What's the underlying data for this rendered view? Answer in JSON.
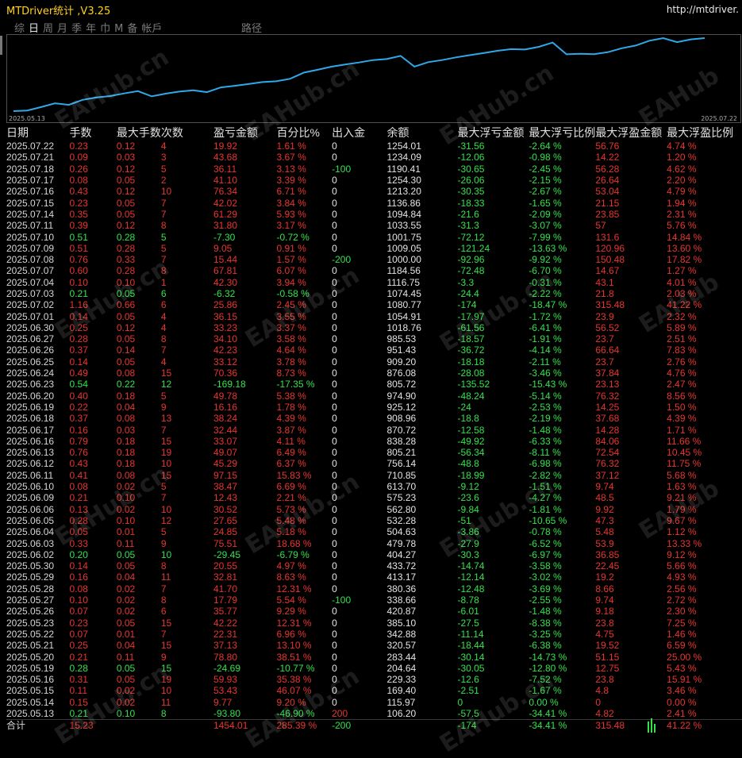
{
  "window": {
    "title": "MTDriver统计 ,V3.25",
    "url": "http://mtdriver."
  },
  "tabs": [
    "综",
    "日",
    "周",
    "月",
    "季",
    "年",
    "巾",
    "M",
    "备",
    "帐戶"
  ],
  "active_tab": 1,
  "path_label": "路径",
  "chart": {
    "x_start": "2025.05.13",
    "x_end": "2025.07.22",
    "line_color": "#2fa8e8",
    "series": [
      106.2,
      115.97,
      169.4,
      229.33,
      204.64,
      283.44,
      320.57,
      342.88,
      385.1,
      420.87,
      338.66,
      380.36,
      413.17,
      433.72,
      404.27,
      479.78,
      504.63,
      532.28,
      562.8,
      575.23,
      613.7,
      710.85,
      756.14,
      805.21,
      838.28,
      870.72,
      908.96,
      925.12,
      974.9,
      805.72,
      876.08,
      909.2,
      951.43,
      985.53,
      1018.76,
      1054.91,
      1080.77,
      1074.45,
      1116.75,
      1184.56,
      1000.0,
      1009.05,
      1001.75,
      1033.55,
      1094.84,
      1136.86,
      1213.2,
      1254.3,
      1190.41,
      1234.09,
      1254.01
    ]
  },
  "table": {
    "headers": [
      "日期",
      "手数",
      "最大手数",
      "次数",
      "盈亏金额",
      "百分比%",
      "出入金",
      "余额",
      "最大浮亏金额",
      "最大浮亏比例",
      "最大浮盈金额",
      "最大浮盈比例"
    ],
    "rows": [
      [
        "2025.07.22",
        "0.23",
        "0.12",
        "4",
        "19.92",
        "1.61 %",
        "0",
        "1254.01",
        "-31.56",
        "-2.64 %",
        "56.76",
        "4.74 %"
      ],
      [
        "2025.07.21",
        "0.09",
        "0.03",
        "3",
        "43.68",
        "3.67 %",
        "0",
        "1234.09",
        "-12.06",
        "-0.98 %",
        "14.22",
        "1.20 %"
      ],
      [
        "2025.07.18",
        "0.26",
        "0.12",
        "5",
        "36.11",
        "3.13 %",
        "-100",
        "1190.41",
        "-30.65",
        "-2.45 %",
        "56.28",
        "4.62 %"
      ],
      [
        "2025.07.17",
        "0.08",
        "0.05",
        "2",
        "41.10",
        "3.39 %",
        "0",
        "1254.30",
        "-26.06",
        "-2.15 %",
        "26.64",
        "2.20 %"
      ],
      [
        "2025.07.16",
        "0.43",
        "0.12",
        "10",
        "76.34",
        "6.71 %",
        "0",
        "1213.20",
        "-30.35",
        "-2.67 %",
        "53.04",
        "4.79 %"
      ],
      [
        "2025.07.15",
        "0.23",
        "0.05",
        "7",
        "42.02",
        "3.84 %",
        "0",
        "1136.86",
        "-18.33",
        "-1.65 %",
        "21.15",
        "1.94 %"
      ],
      [
        "2025.07.14",
        "0.35",
        "0.05",
        "7",
        "61.29",
        "5.93 %",
        "0",
        "1094.84",
        "-21.6",
        "-2.09 %",
        "23.85",
        "2.31 %"
      ],
      [
        "2025.07.11",
        "0.39",
        "0.12",
        "8",
        "31.80",
        "3.17 %",
        "0",
        "1033.55",
        "-31.3",
        "-3.07 %",
        "57",
        "5.76 %"
      ],
      [
        "2025.07.10",
        "0.51",
        "0.28",
        "5",
        "-7.30",
        "-0.72 %",
        "0",
        "1001.75",
        "-72.12",
        "-7.99 %",
        "131.6",
        "14.84 %"
      ],
      [
        "2025.07.09",
        "0.51",
        "0.28",
        "5",
        "9.05",
        "0.91 %",
        "0",
        "1009.05",
        "-121.24",
        "-13.63 %",
        "120.96",
        "13.60 %"
      ],
      [
        "2025.07.08",
        "0.76",
        "0.33",
        "7",
        "15.44",
        "1.57 %",
        "-200",
        "1000.00",
        "-92.96",
        "-9.92 %",
        "150.48",
        "17.82 %"
      ],
      [
        "2025.07.07",
        "0.60",
        "0.28",
        "8",
        "67.81",
        "6.07 %",
        "0",
        "1184.56",
        "-72.48",
        "-6.70 %",
        "14.67",
        "1.27 %"
      ],
      [
        "2025.07.04",
        "0.10",
        "0.10",
        "1",
        "42.30",
        "3.94 %",
        "0",
        "1116.75",
        "-3.3",
        "-0.31 %",
        "43.1",
        "4.01 %"
      ],
      [
        "2025.07.03",
        "0.21",
        "0.05",
        "6",
        "-6.32",
        "-0.58 %",
        "0",
        "1074.45",
        "-24.4",
        "-2.22 %",
        "21.8",
        "2.03 %"
      ],
      [
        "2025.07.02",
        "1.16",
        "0.66",
        "6",
        "25.86",
        "2.45 %",
        "0",
        "1080.77",
        "-174",
        "-18.47 %",
        "315.48",
        "41.22 %"
      ],
      [
        "2025.07.01",
        "0.14",
        "0.05",
        "4",
        "36.15",
        "3.55 %",
        "0",
        "1054.91",
        "-17.97",
        "-1.72 %",
        "23.9",
        "2.32 %"
      ],
      [
        "2025.06.30",
        "0.25",
        "0.12",
        "4",
        "33.23",
        "3.37 %",
        "0",
        "1018.76",
        "-61.56",
        "-6.41 %",
        "56.52",
        "5.89 %"
      ],
      [
        "2025.06.27",
        "0.28",
        "0.05",
        "8",
        "34.10",
        "3.58 %",
        "0",
        "985.53",
        "-18.57",
        "-1.91 %",
        "23.7",
        "2.51 %"
      ],
      [
        "2025.06.26",
        "0.37",
        "0.14",
        "7",
        "42.23",
        "4.64 %",
        "0",
        "951.43",
        "-36.72",
        "-4.14 %",
        "66.64",
        "7.83 %"
      ],
      [
        "2025.06.25",
        "0.14",
        "0.05",
        "4",
        "33.12",
        "3.78 %",
        "0",
        "909.20",
        "-18.18",
        "-2.11 %",
        "23.7",
        "2.76 %"
      ],
      [
        "2025.06.24",
        "0.49",
        "0.08",
        "15",
        "70.36",
        "8.73 %",
        "0",
        "876.08",
        "-28.08",
        "-3.46 %",
        "37.84",
        "4.76 %"
      ],
      [
        "2025.06.23",
        "0.54",
        "0.22",
        "12",
        "-169.18",
        "-17.35 %",
        "0",
        "805.72",
        "-135.52",
        "-15.43 %",
        "23.13",
        "2.47 %"
      ],
      [
        "2025.06.20",
        "0.40",
        "0.18",
        "5",
        "49.78",
        "5.38 %",
        "0",
        "974.90",
        "-48.24",
        "-5.14 %",
        "76.32",
        "8.56 %"
      ],
      [
        "2025.06.19",
        "0.22",
        "0.04",
        "9",
        "16.16",
        "1.78 %",
        "0",
        "925.12",
        "-24",
        "-2.53 %",
        "14.25",
        "1.50 %"
      ],
      [
        "2025.06.18",
        "0.37",
        "0.08",
        "13",
        "38.24",
        "4.39 %",
        "0",
        "908.96",
        "-18.8",
        "-2.19 %",
        "37.68",
        "4.39 %"
      ],
      [
        "2025.06.17",
        "0.16",
        "0.03",
        "7",
        "32.44",
        "3.87 %",
        "0",
        "870.72",
        "-12.58",
        "-1.48 %",
        "14.28",
        "1.71 %"
      ],
      [
        "2025.06.16",
        "0.79",
        "0.18",
        "15",
        "33.07",
        "4.11 %",
        "0",
        "838.28",
        "-49.92",
        "-6.33 %",
        "84.06",
        "11.66 %"
      ],
      [
        "2025.06.13",
        "0.76",
        "0.18",
        "19",
        "49.07",
        "6.49 %",
        "0",
        "805.21",
        "-56.34",
        "-8.11 %",
        "72.54",
        "10.45 %"
      ],
      [
        "2025.06.12",
        "0.43",
        "0.18",
        "10",
        "45.29",
        "6.37 %",
        "0",
        "756.14",
        "-48.8",
        "-6.98 %",
        "76.32",
        "11.75 %"
      ],
      [
        "2025.06.11",
        "0.41",
        "0.08",
        "15",
        "97.15",
        "15.83 %",
        "0",
        "710.85",
        "-18.99",
        "-2.82 %",
        "37.12",
        "5.68 %"
      ],
      [
        "2025.06.10",
        "0.08",
        "0.02",
        "5",
        "38.47",
        "6.69 %",
        "0",
        "613.70",
        "-9.12",
        "-1.51 %",
        "9.74",
        "1.63 %"
      ],
      [
        "2025.06.09",
        "0.21",
        "0.10",
        "7",
        "12.43",
        "2.21 %",
        "0",
        "575.23",
        "-23.6",
        "-4.27 %",
        "48.5",
        "9.21 %"
      ],
      [
        "2025.06.06",
        "0.13",
        "0.02",
        "10",
        "30.52",
        "5.73 %",
        "0",
        "562.80",
        "-9.84",
        "-1.81 %",
        "9.92",
        "1.79 %"
      ],
      [
        "2025.06.05",
        "0.28",
        "0.10",
        "12",
        "27.65",
        "5.48 %",
        "0",
        "532.28",
        "-51",
        "-10.65 %",
        "47.3",
        "9.67 %"
      ],
      [
        "2025.06.04",
        "0.05",
        "0.01",
        "5",
        "24.85",
        "5.18 %",
        "0",
        "504.63",
        "-3.86",
        "-0.78 %",
        "5.48",
        "1.12 %"
      ],
      [
        "2025.06.03",
        "0.33",
        "0.11",
        "9",
        "75.51",
        "18.68 %",
        "0",
        "479.78",
        "-27.9",
        "-6.52 %",
        "53.9",
        "13.33 %"
      ],
      [
        "2025.06.02",
        "0.20",
        "0.05",
        "10",
        "-29.45",
        "-6.79 %",
        "0",
        "404.27",
        "-30.3",
        "-6.97 %",
        "36.85",
        "9.12 %"
      ],
      [
        "2025.05.30",
        "0.14",
        "0.05",
        "8",
        "20.55",
        "4.97 %",
        "0",
        "433.72",
        "-14.74",
        "-3.58 %",
        "22.45",
        "5.66 %"
      ],
      [
        "2025.05.29",
        "0.16",
        "0.04",
        "11",
        "32.81",
        "8.63 %",
        "0",
        "413.17",
        "-12.14",
        "-3.02 %",
        "19.2",
        "4.93 %"
      ],
      [
        "2025.05.28",
        "0.08",
        "0.02",
        "7",
        "41.70",
        "12.31 %",
        "0",
        "380.36",
        "-12.48",
        "-3.69 %",
        "8.66",
        "2.56 %"
      ],
      [
        "2025.05.27",
        "0.10",
        "0.02",
        "8",
        "17.79",
        "5.54 %",
        "-100",
        "338.66",
        "-8.78",
        "-2.55 %",
        "9.74",
        "2.72 %"
      ],
      [
        "2025.05.26",
        "0.07",
        "0.02",
        "6",
        "35.77",
        "9.29 %",
        "0",
        "420.87",
        "-6.01",
        "-1.48 %",
        "9.18",
        "2.30 %"
      ],
      [
        "2025.05.23",
        "0.23",
        "0.05",
        "15",
        "42.22",
        "12.31 %",
        "0",
        "385.10",
        "-27.5",
        "-8.38 %",
        "23.8",
        "7.25 %"
      ],
      [
        "2025.05.22",
        "0.07",
        "0.01",
        "7",
        "22.31",
        "6.96 %",
        "0",
        "342.88",
        "-11.14",
        "-3.25 %",
        "4.75",
        "1.46 %"
      ],
      [
        "2025.05.21",
        "0.25",
        "0.04",
        "15",
        "37.13",
        "13.10 %",
        "0",
        "320.57",
        "-18.44",
        "-6.38 %",
        "19.52",
        "6.59 %"
      ],
      [
        "2025.05.20",
        "0.21",
        "0.11",
        "9",
        "78.80",
        "38.51 %",
        "0",
        "283.44",
        "-30.14",
        "-14.73 %",
        "51.15",
        "25.00 %"
      ],
      [
        "2025.05.19",
        "0.28",
        "0.05",
        "15",
        "-24.69",
        "-10.77 %",
        "0",
        "204.64",
        "-30.05",
        "-12.80 %",
        "12.75",
        "5.43 %"
      ],
      [
        "2025.05.16",
        "0.31",
        "0.05",
        "19",
        "59.93",
        "35.38 %",
        "0",
        "229.33",
        "-12.6",
        "-7.52 %",
        "23.8",
        "15.91 %"
      ],
      [
        "2025.05.15",
        "0.11",
        "0.02",
        "10",
        "53.43",
        "46.07 %",
        "0",
        "169.40",
        "-2.51",
        "-1.67 %",
        "4.8",
        "3.46 %"
      ],
      [
        "2025.05.14",
        "0.15",
        "0.02",
        "11",
        "9.77",
        "9.20 %",
        "0",
        "115.97",
        "0",
        "0.00 %",
        "0",
        "0.00 %"
      ],
      [
        "2025.05.13",
        "0.21",
        "0.10",
        "8",
        "-93.80",
        "-46.90 %",
        "200",
        "106.20",
        "-57.5",
        "-34.41 %",
        "4.82",
        "2.41 %"
      ]
    ],
    "total": [
      "合计",
      "15.23",
      "",
      "",
      "1454.01",
      "285.39 %",
      "-200",
      "",
      "-174",
      "-34.41 %",
      "315.48",
      "41.22 %"
    ]
  }
}
